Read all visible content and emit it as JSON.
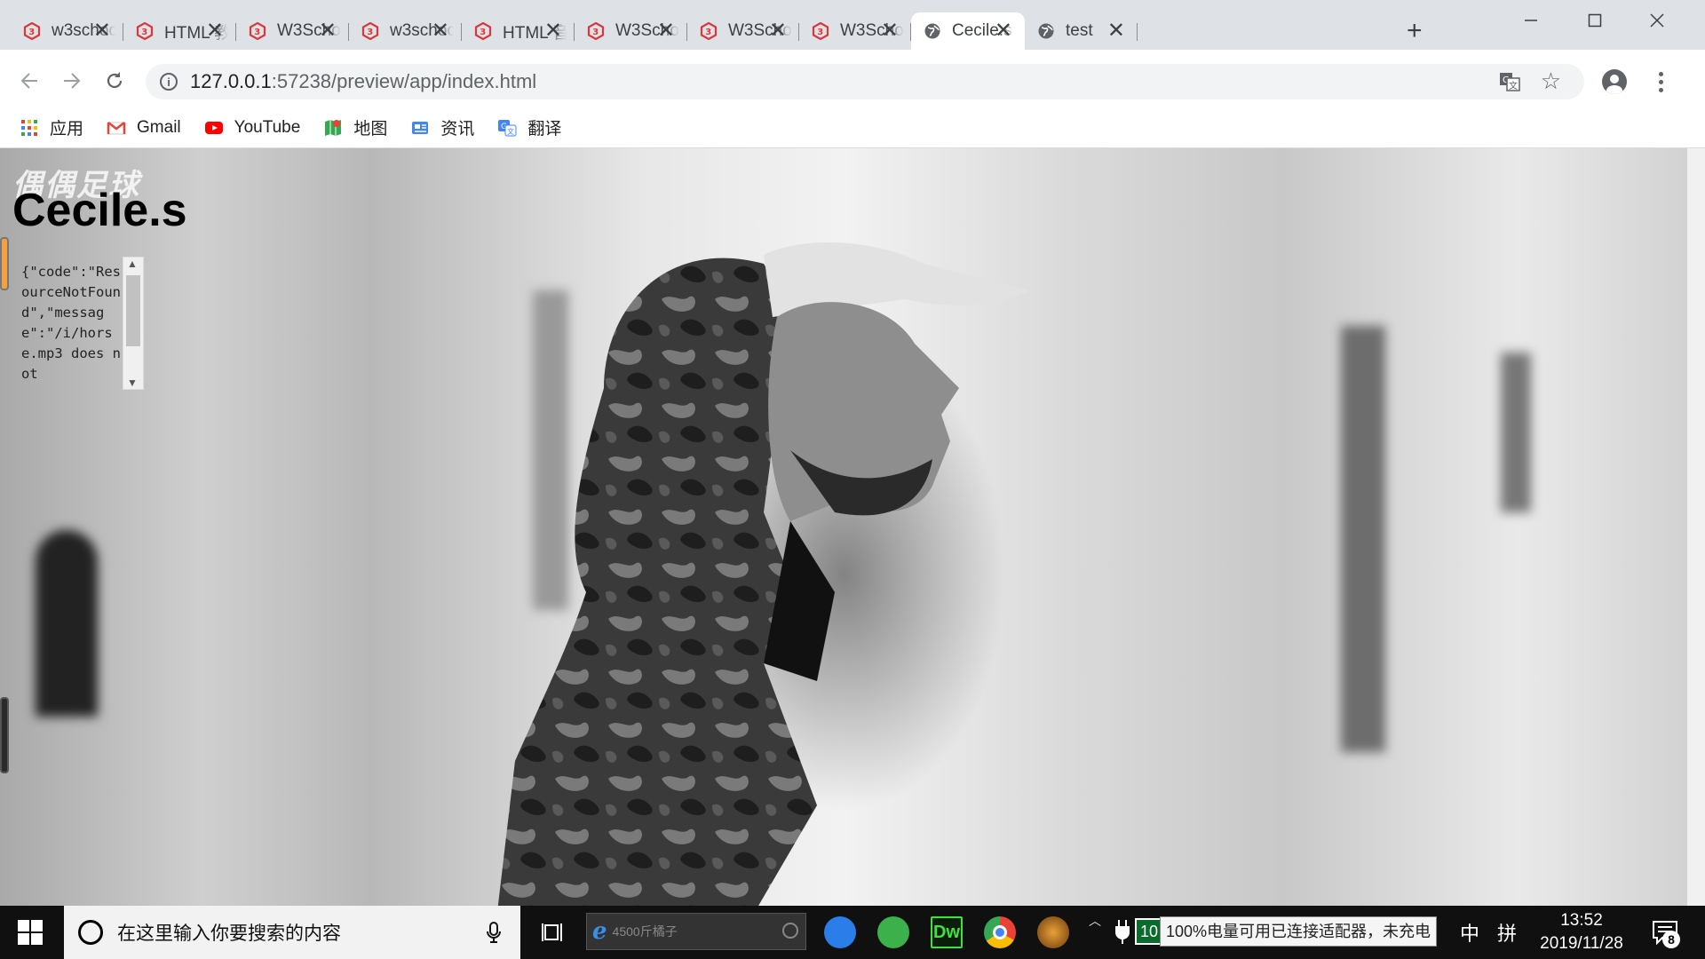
{
  "window": {
    "tabs": [
      {
        "title": "w3schools.com",
        "icon": "w3schools-icon",
        "active": false
      },
      {
        "title": "HTML 教程",
        "icon": "w3schools-icon",
        "active": false
      },
      {
        "title": "W3School",
        "icon": "w3schools-icon",
        "active": false
      },
      {
        "title": "w3school",
        "icon": "w3schools-icon",
        "active": false
      },
      {
        "title": "HTML 音频",
        "icon": "w3schools-icon",
        "active": false
      },
      {
        "title": "W3School",
        "icon": "w3schools-icon",
        "active": false
      },
      {
        "title": "W3School",
        "icon": "w3schools-icon",
        "active": false
      },
      {
        "title": "W3School",
        "icon": "w3schools-icon",
        "active": false
      },
      {
        "title": "Cecile.s",
        "icon": "globe-icon",
        "active": true
      },
      {
        "title": "test",
        "icon": "globe-icon",
        "active": false
      }
    ],
    "close_glyph": "✕",
    "new_tab_glyph": "+"
  },
  "toolbar": {
    "url_host": "127.0.0.1",
    "url_rest": ":57238/preview/app/index.html",
    "info_glyph": "i",
    "star_glyph": "☆"
  },
  "bookmarks": [
    {
      "label": "应用",
      "icon": "apps-grid-icon"
    },
    {
      "label": "Gmail",
      "icon": "gmail-icon"
    },
    {
      "label": "YouTube",
      "icon": "youtube-icon"
    },
    {
      "label": "地图",
      "icon": "maps-icon"
    },
    {
      "label": "资讯",
      "icon": "news-icon"
    },
    {
      "label": "翻译",
      "icon": "translate-icon"
    }
  ],
  "page": {
    "logo_watermark": "偶偶足球",
    "site_title": "Cecile.s",
    "player_error_text": "{\"code\":\"ResourceNotFound\",\"message\":\"/i/horse.mp3 does not",
    "scroll_up": "▲",
    "scroll_down": "▼"
  },
  "taskbar": {
    "search_placeholder": "在这里输入你要搜索的内容",
    "ie_search_text": "4500斤橘子",
    "battery_percent": "10",
    "battery_tooltip": "100%电量可用已连接适配器，未充电",
    "ime_lang": "中",
    "ime_mode": "拼",
    "time": "13:52",
    "date": "2019/11/28",
    "notifications": "8",
    "tray_up": "︿"
  },
  "colors": {
    "accent": "#1a73e8",
    "w3_red": "#d9383b",
    "taskbar": "#101010"
  }
}
